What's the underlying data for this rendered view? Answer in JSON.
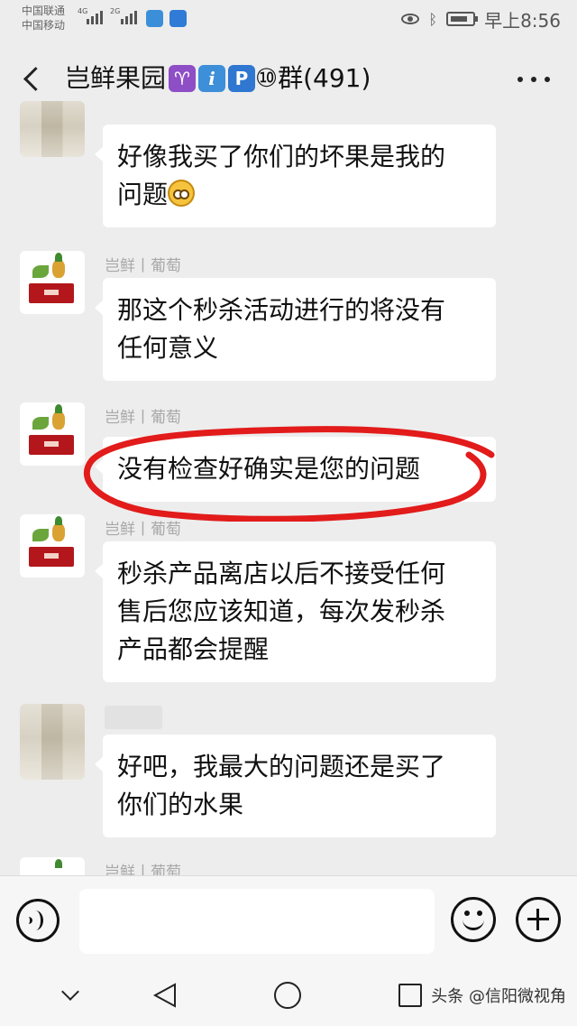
{
  "status_bar": {
    "carrier_1": "中国联通",
    "carrier_2": "中国移动",
    "network_1": "4G",
    "network_2": "2G",
    "time": "早上8:56",
    "icons": [
      "signal-icon",
      "wifi-badge-icon",
      "eye-icon",
      "bluetooth-icon",
      "battery-icon"
    ]
  },
  "header": {
    "title_prefix": "岂鲜果园",
    "title_badge_1": "♈",
    "title_badge_2": "i",
    "title_badge_3": "P",
    "title_suffix": "⑩群(491)",
    "badge_colors": [
      "#8e4ec6",
      "#3c8fd8",
      "#2f77d0"
    ]
  },
  "messages": [
    {
      "sender": "",
      "avatar": "blurred-avatar",
      "line1": "好像我买了你们的坏果是我的",
      "line2": "问题"
    },
    {
      "sender": "岂鲜丨葡萄",
      "avatar": "shop-avatar",
      "line1": "那这个秒杀活动进行的将没有",
      "line2": "任何意义"
    },
    {
      "sender": "岂鲜丨葡萄",
      "avatar": "shop-avatar",
      "line1": "没有检查好确实是您的问题"
    },
    {
      "sender": "岂鲜丨葡萄",
      "avatar": "shop-avatar",
      "line1": "秒杀产品离店以后不接受任何",
      "line2": "售后您应该知道，每次发秒杀",
      "line3": "产品都会提醒"
    },
    {
      "sender": "",
      "avatar": "blurred-avatar",
      "line1": "好吧，我最大的问题还是买了",
      "line2": "你们的水果"
    },
    {
      "sender": "岂鲜丨葡萄",
      "avatar": "shop-avatar"
    }
  ],
  "input": {
    "value": "",
    "placeholder": ""
  },
  "watermark": "头条 @信阳微视角",
  "colors": {
    "annotation": "#e21b1b",
    "background": "#ededed",
    "bubble": "#ffffff"
  }
}
